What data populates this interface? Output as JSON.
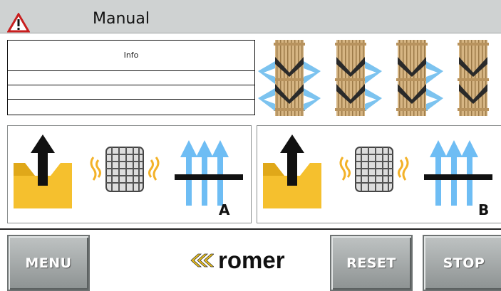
{
  "header": {
    "title": "Manual",
    "alarm_icon": "warning-triangle-icon"
  },
  "info": {
    "label": "Info"
  },
  "panels": [
    {
      "label": "A"
    },
    {
      "label": "B"
    }
  ],
  "footer": {
    "menu_label": "MENU",
    "reset_label": "RESET",
    "stop_label": "STOP",
    "brand": "romer",
    "brand_icon": "triple-chevron-left-icon"
  },
  "colors": {
    "header_bg": "#cfd2d2",
    "box_yellow": "#f5c02e",
    "arrow_blue": "#6ebdf4",
    "wave_orange": "#f3b228",
    "wood": "#c9a673"
  }
}
